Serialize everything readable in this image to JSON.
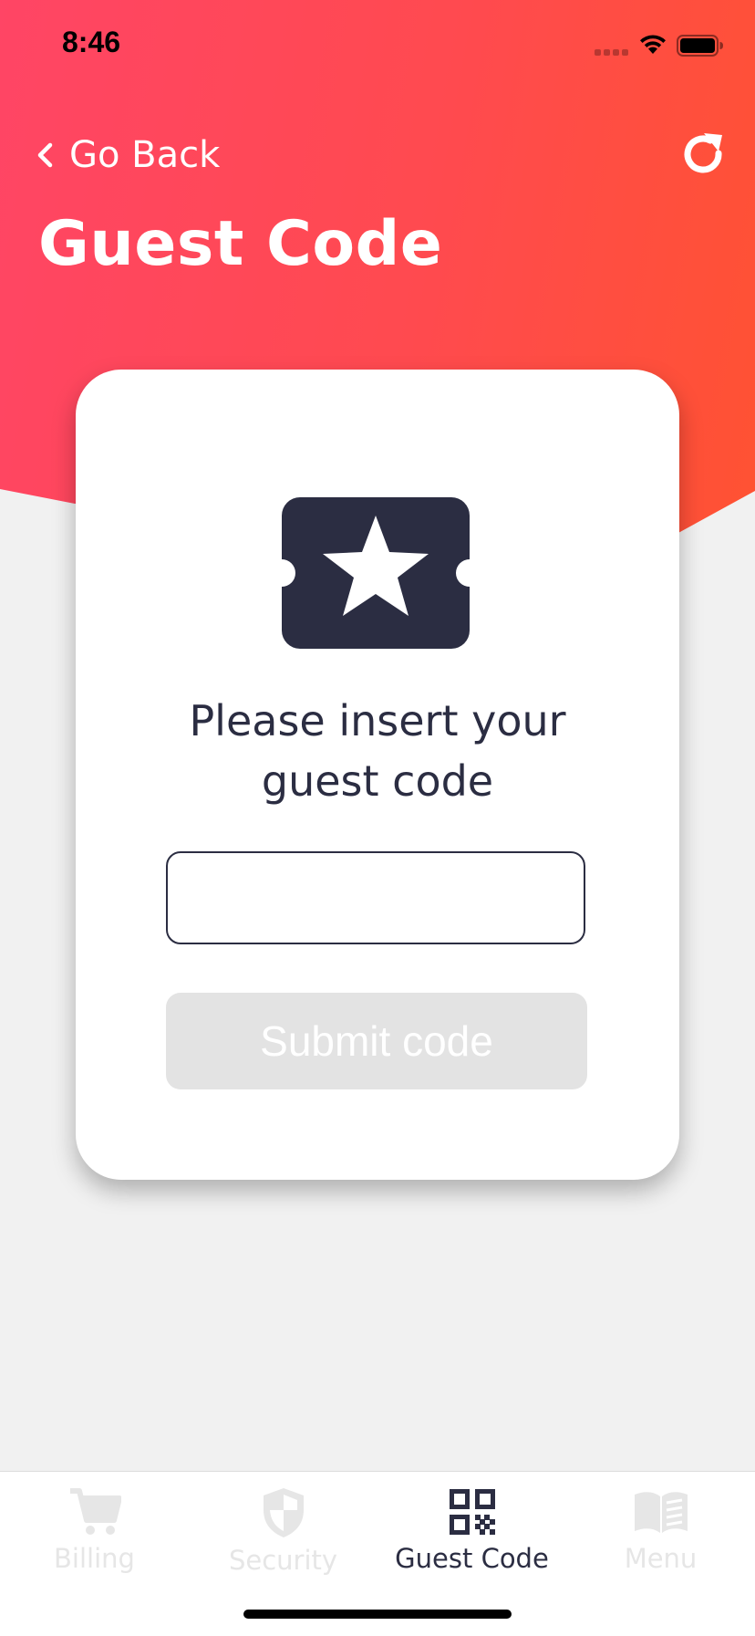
{
  "status_bar": {
    "time": "8:46"
  },
  "header": {
    "back_label": "Go Back",
    "title": "Guest Code",
    "icons": {
      "back": "chevron-left-icon",
      "refresh": "refresh-icon"
    }
  },
  "card": {
    "icon": "ticket-star-icon",
    "prompt": "Please insert your guest code",
    "input": {
      "value": "",
      "placeholder": ""
    },
    "submit_label": "Submit code"
  },
  "tab_bar": {
    "active": "Guest Code",
    "items": [
      {
        "label": "Billing",
        "icon": "cart-icon"
      },
      {
        "label": "Security",
        "icon": "shield-icon"
      },
      {
        "label": "Guest Code",
        "icon": "qr-code-icon"
      },
      {
        "label": "Menu",
        "icon": "book-icon"
      }
    ]
  },
  "colors": {
    "gradient_start": "#ff4565",
    "gradient_end": "#ff5232",
    "dark": "#2b2d42",
    "background": "#f1f1f1",
    "disabled_button": "#e3e3e3",
    "inactive_tab": "#e6e6e6"
  }
}
